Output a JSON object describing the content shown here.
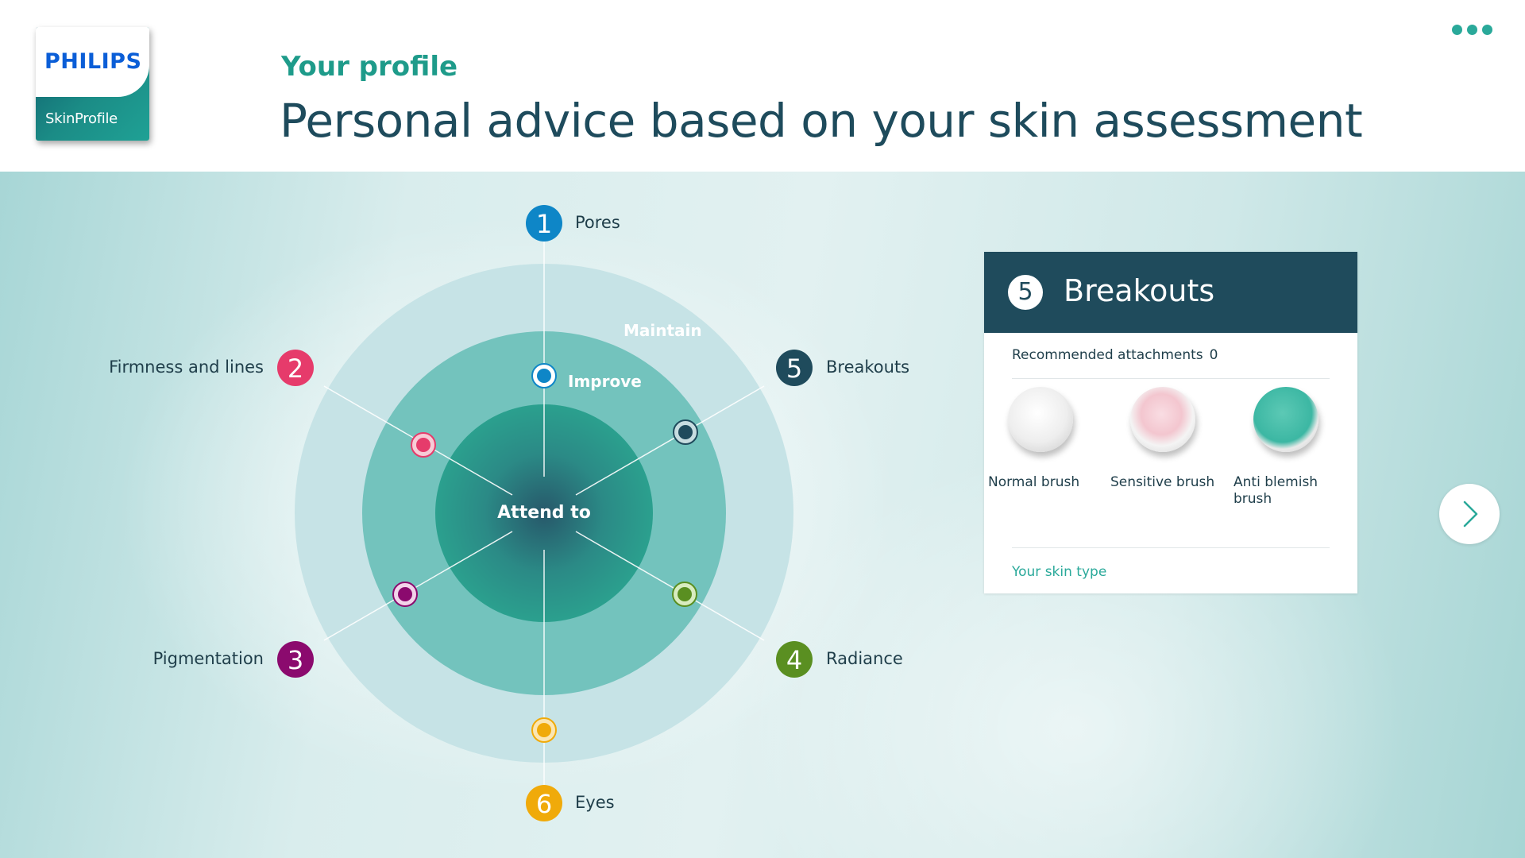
{
  "brand": {
    "name": "PHILIPS",
    "product": "SkinProfile"
  },
  "header": {
    "kicker": "Your profile",
    "title": "Personal advice based on your skin assessment",
    "menu_icon": "more-dots-icon"
  },
  "wheel": {
    "rings": {
      "outer": "Maintain",
      "middle": "Improve",
      "center": "Attend to"
    },
    "categories": [
      {
        "number": "1",
        "label": "Pores",
        "color": "#0e86c7",
        "level": "Improve"
      },
      {
        "number": "2",
        "label": "Firmness and lines",
        "color": "#e63b6b",
        "level": "Improve"
      },
      {
        "number": "3",
        "label": "Pigmentation",
        "color": "#8b0a6e",
        "level": "Improve"
      },
      {
        "number": "4",
        "label": "Radiance",
        "color": "#5a8f21",
        "level": "Improve"
      },
      {
        "number": "5",
        "label": "Breakouts",
        "color": "#1f4b5c",
        "level": "Improve"
      },
      {
        "number": "6",
        "label": "Eyes",
        "color": "#f0aa0a",
        "level": "Maintain"
      }
    ]
  },
  "detail": {
    "number": "5",
    "title": "Breakouts",
    "subtitle": "Recommended attachments",
    "count": "0",
    "attachments": [
      {
        "label": "Normal brush",
        "color": "#f0f0f0",
        "icon": "normal-brush-icon"
      },
      {
        "label": "Sensitive brush",
        "color": "#f3c6cf",
        "icon": "sensitive-brush-icon"
      },
      {
        "label": "Anti blemish brush",
        "color": "#3cb7a3",
        "icon": "anti-blemish-brush-icon"
      }
    ],
    "link": "Your skin type"
  },
  "colors": {
    "accent": "#2aa99a",
    "dark": "#1f4b5c"
  }
}
